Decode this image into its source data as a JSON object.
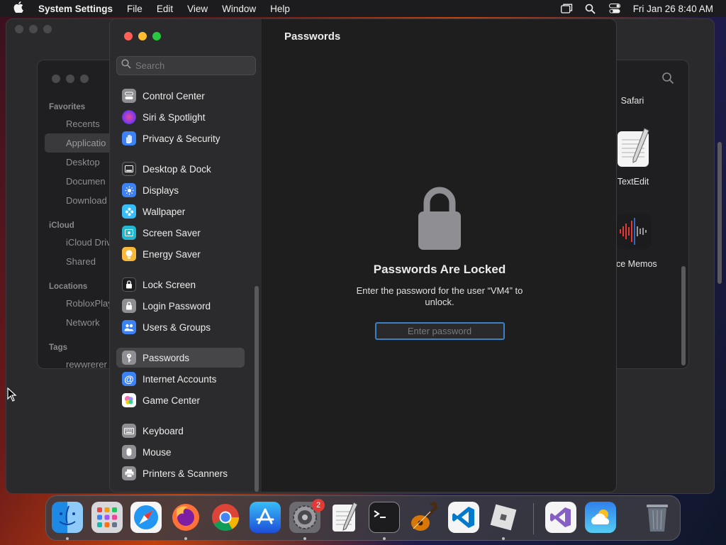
{
  "menubar": {
    "app_name": "System Settings",
    "menus": [
      "File",
      "Edit",
      "View",
      "Window",
      "Help"
    ],
    "clock": "Fri Jan 26  8:40 AM"
  },
  "finder": {
    "favorites_label": "Favorites",
    "favorites": [
      "Recents",
      "Applicatio",
      "Desktop",
      "Documen",
      "Download"
    ],
    "icloud_label": "iCloud",
    "icloud": [
      "iCloud Driv",
      "Shared"
    ],
    "locations_label": "Locations",
    "locations": [
      "RobloxPlay",
      "Network"
    ],
    "tags_label": "Tags",
    "tags": [
      "rewwrerer"
    ],
    "apps": [
      "Safari",
      "TextEdit",
      "ce Memos"
    ]
  },
  "settings": {
    "search_placeholder": "Search",
    "sidebar": [
      {
        "label": "Control Center",
        "icon": "control-center-icon",
        "color": "#8e8e93"
      },
      {
        "label": "Siri & Spotlight",
        "icon": "siri-icon",
        "color": "#a855f7"
      },
      {
        "label": "Privacy & Security",
        "icon": "hand-icon",
        "color": "#3b82f6"
      },
      {
        "label": "Desktop & Dock",
        "icon": "dock-icon",
        "color": "#2c2c2e"
      },
      {
        "label": "Displays",
        "icon": "sun-icon",
        "color": "#3b82f6"
      },
      {
        "label": "Wallpaper",
        "icon": "flower-icon",
        "color": "#38bdf8"
      },
      {
        "label": "Screen Saver",
        "icon": "screen-saver-icon",
        "color": "#22b8cf"
      },
      {
        "label": "Energy Saver",
        "icon": "bulb-icon",
        "color": "#f6b93b"
      },
      {
        "label": "Lock Screen",
        "icon": "lock-icon",
        "color": "#2c2c2e"
      },
      {
        "label": "Login Password",
        "icon": "lock-icon",
        "color": "#8e8e93"
      },
      {
        "label": "Users & Groups",
        "icon": "users-icon",
        "color": "#3b82f6"
      },
      {
        "label": "Passwords",
        "icon": "key-icon",
        "color": "#8e8e93"
      },
      {
        "label": "Internet Accounts",
        "icon": "at-icon",
        "color": "#3b82f6"
      },
      {
        "label": "Game Center",
        "icon": "game-center-icon",
        "color": "#ffffff"
      },
      {
        "label": "Keyboard",
        "icon": "keyboard-icon",
        "color": "#8e8e93"
      },
      {
        "label": "Mouse",
        "icon": "mouse-icon",
        "color": "#8e8e93"
      },
      {
        "label": "Printers & Scanners",
        "icon": "printer-icon",
        "color": "#8e8e93"
      }
    ],
    "active_item": "Passwords",
    "content_title": "Passwords",
    "locked_title": "Passwords Are Locked",
    "locked_message": "Enter the password for the user “VM4” to unlock.",
    "password_placeholder": "Enter password"
  },
  "dock": {
    "apps": [
      "Finder",
      "Launchpad",
      "Safari",
      "Firefox",
      "Chrome",
      "App Store",
      "System Settings",
      "TextEdit",
      "Terminal",
      "GarageBand",
      "Visual Studio Code",
      "Roblox",
      "Visual Studio",
      "Weather",
      "Trash"
    ],
    "settings_badge": "2"
  }
}
